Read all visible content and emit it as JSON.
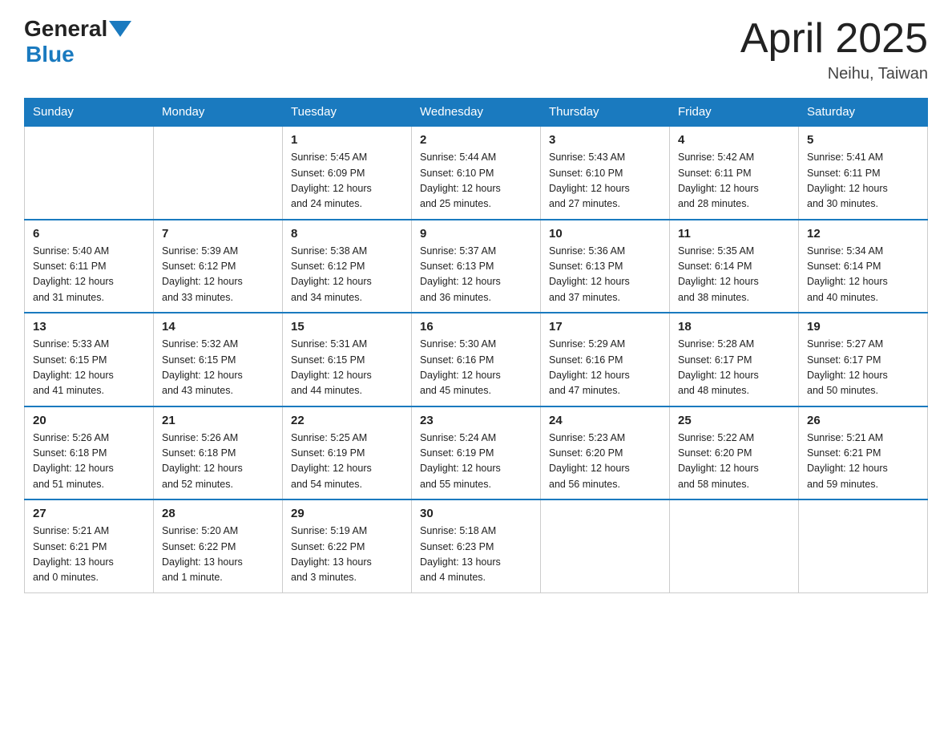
{
  "header": {
    "logo_general": "General",
    "logo_blue": "Blue",
    "month": "April 2025",
    "location": "Neihu, Taiwan"
  },
  "days_of_week": [
    "Sunday",
    "Monday",
    "Tuesday",
    "Wednesday",
    "Thursday",
    "Friday",
    "Saturday"
  ],
  "weeks": [
    [
      {
        "day": "",
        "info": ""
      },
      {
        "day": "",
        "info": ""
      },
      {
        "day": "1",
        "info": "Sunrise: 5:45 AM\nSunset: 6:09 PM\nDaylight: 12 hours\nand 24 minutes."
      },
      {
        "day": "2",
        "info": "Sunrise: 5:44 AM\nSunset: 6:10 PM\nDaylight: 12 hours\nand 25 minutes."
      },
      {
        "day": "3",
        "info": "Sunrise: 5:43 AM\nSunset: 6:10 PM\nDaylight: 12 hours\nand 27 minutes."
      },
      {
        "day": "4",
        "info": "Sunrise: 5:42 AM\nSunset: 6:11 PM\nDaylight: 12 hours\nand 28 minutes."
      },
      {
        "day": "5",
        "info": "Sunrise: 5:41 AM\nSunset: 6:11 PM\nDaylight: 12 hours\nand 30 minutes."
      }
    ],
    [
      {
        "day": "6",
        "info": "Sunrise: 5:40 AM\nSunset: 6:11 PM\nDaylight: 12 hours\nand 31 minutes."
      },
      {
        "day": "7",
        "info": "Sunrise: 5:39 AM\nSunset: 6:12 PM\nDaylight: 12 hours\nand 33 minutes."
      },
      {
        "day": "8",
        "info": "Sunrise: 5:38 AM\nSunset: 6:12 PM\nDaylight: 12 hours\nand 34 minutes."
      },
      {
        "day": "9",
        "info": "Sunrise: 5:37 AM\nSunset: 6:13 PM\nDaylight: 12 hours\nand 36 minutes."
      },
      {
        "day": "10",
        "info": "Sunrise: 5:36 AM\nSunset: 6:13 PM\nDaylight: 12 hours\nand 37 minutes."
      },
      {
        "day": "11",
        "info": "Sunrise: 5:35 AM\nSunset: 6:14 PM\nDaylight: 12 hours\nand 38 minutes."
      },
      {
        "day": "12",
        "info": "Sunrise: 5:34 AM\nSunset: 6:14 PM\nDaylight: 12 hours\nand 40 minutes."
      }
    ],
    [
      {
        "day": "13",
        "info": "Sunrise: 5:33 AM\nSunset: 6:15 PM\nDaylight: 12 hours\nand 41 minutes."
      },
      {
        "day": "14",
        "info": "Sunrise: 5:32 AM\nSunset: 6:15 PM\nDaylight: 12 hours\nand 43 minutes."
      },
      {
        "day": "15",
        "info": "Sunrise: 5:31 AM\nSunset: 6:15 PM\nDaylight: 12 hours\nand 44 minutes."
      },
      {
        "day": "16",
        "info": "Sunrise: 5:30 AM\nSunset: 6:16 PM\nDaylight: 12 hours\nand 45 minutes."
      },
      {
        "day": "17",
        "info": "Sunrise: 5:29 AM\nSunset: 6:16 PM\nDaylight: 12 hours\nand 47 minutes."
      },
      {
        "day": "18",
        "info": "Sunrise: 5:28 AM\nSunset: 6:17 PM\nDaylight: 12 hours\nand 48 minutes."
      },
      {
        "day": "19",
        "info": "Sunrise: 5:27 AM\nSunset: 6:17 PM\nDaylight: 12 hours\nand 50 minutes."
      }
    ],
    [
      {
        "day": "20",
        "info": "Sunrise: 5:26 AM\nSunset: 6:18 PM\nDaylight: 12 hours\nand 51 minutes."
      },
      {
        "day": "21",
        "info": "Sunrise: 5:26 AM\nSunset: 6:18 PM\nDaylight: 12 hours\nand 52 minutes."
      },
      {
        "day": "22",
        "info": "Sunrise: 5:25 AM\nSunset: 6:19 PM\nDaylight: 12 hours\nand 54 minutes."
      },
      {
        "day": "23",
        "info": "Sunrise: 5:24 AM\nSunset: 6:19 PM\nDaylight: 12 hours\nand 55 minutes."
      },
      {
        "day": "24",
        "info": "Sunrise: 5:23 AM\nSunset: 6:20 PM\nDaylight: 12 hours\nand 56 minutes."
      },
      {
        "day": "25",
        "info": "Sunrise: 5:22 AM\nSunset: 6:20 PM\nDaylight: 12 hours\nand 58 minutes."
      },
      {
        "day": "26",
        "info": "Sunrise: 5:21 AM\nSunset: 6:21 PM\nDaylight: 12 hours\nand 59 minutes."
      }
    ],
    [
      {
        "day": "27",
        "info": "Sunrise: 5:21 AM\nSunset: 6:21 PM\nDaylight: 13 hours\nand 0 minutes."
      },
      {
        "day": "28",
        "info": "Sunrise: 5:20 AM\nSunset: 6:22 PM\nDaylight: 13 hours\nand 1 minute."
      },
      {
        "day": "29",
        "info": "Sunrise: 5:19 AM\nSunset: 6:22 PM\nDaylight: 13 hours\nand 3 minutes."
      },
      {
        "day": "30",
        "info": "Sunrise: 5:18 AM\nSunset: 6:23 PM\nDaylight: 13 hours\nand 4 minutes."
      },
      {
        "day": "",
        "info": ""
      },
      {
        "day": "",
        "info": ""
      },
      {
        "day": "",
        "info": ""
      }
    ]
  ]
}
